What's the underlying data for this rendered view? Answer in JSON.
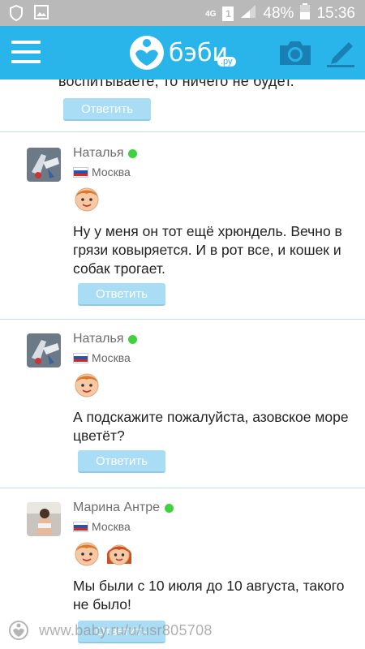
{
  "statusbar": {
    "network": "4G",
    "sim": "1",
    "battery_pct": "48%",
    "time": "15:36"
  },
  "appbar": {
    "logo_text": "бэби",
    "logo_domain": ".ру"
  },
  "top_fragment": {
    "text": "воспитываете, то ничего не будет.",
    "reply_label": "Ответить"
  },
  "comments": [
    {
      "author": "Наталья",
      "city": "Москва",
      "text": "Ну у меня он тот ещё хрюндель. Вечно в грязи ковыряется. И в рот все, и кошек и собак трогает.",
      "reply_label": "Ответить"
    },
    {
      "author": "Наталья",
      "city": "Москва",
      "text": "А подскажите пожалуйста, азовское море цветёт?",
      "reply_label": "Ответить"
    },
    {
      "author": "Марина Антре",
      "city": "Москва",
      "text": "Мы были с 10 июля до 10 августа, такого не было!",
      "reply_label": "Ответить"
    }
  ],
  "watermark": "www.baby.ru/u/usr805708",
  "colors": {
    "brand": "#29b5ea",
    "reply_button": "#a9dcf5",
    "online": "#3fd23f"
  }
}
